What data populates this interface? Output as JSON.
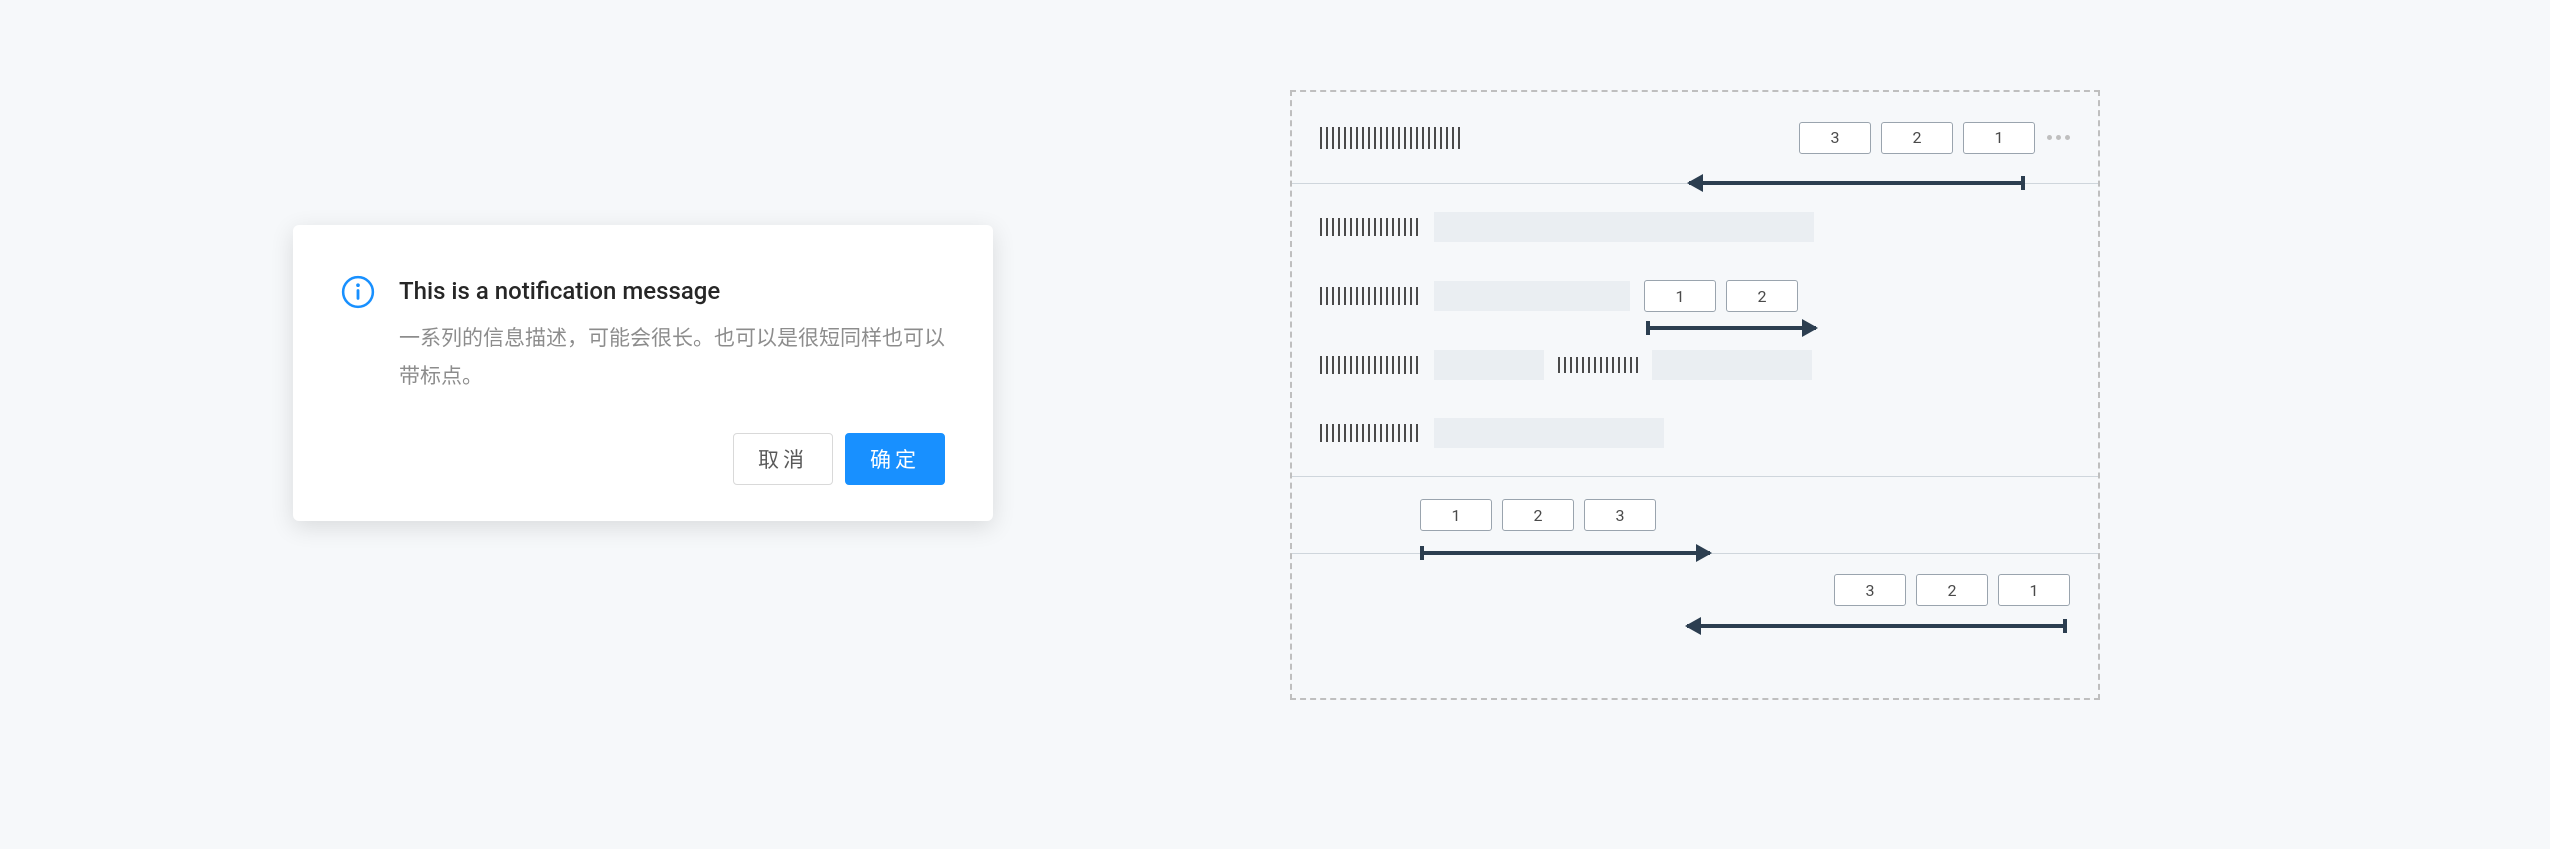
{
  "modal": {
    "title": "This is a notification message",
    "description": "一系列的信息描述，可能会很长。也可以是很短同样也可以带标点。",
    "cancel_label": "取消",
    "confirm_label": "确定"
  },
  "diagram": {
    "header_buttons": [
      "3",
      "2",
      "1"
    ],
    "inline_buttons": [
      "1",
      "2"
    ],
    "footer1_buttons": [
      "1",
      "2",
      "3"
    ],
    "footer2_buttons": [
      "3",
      "2",
      "1"
    ]
  }
}
